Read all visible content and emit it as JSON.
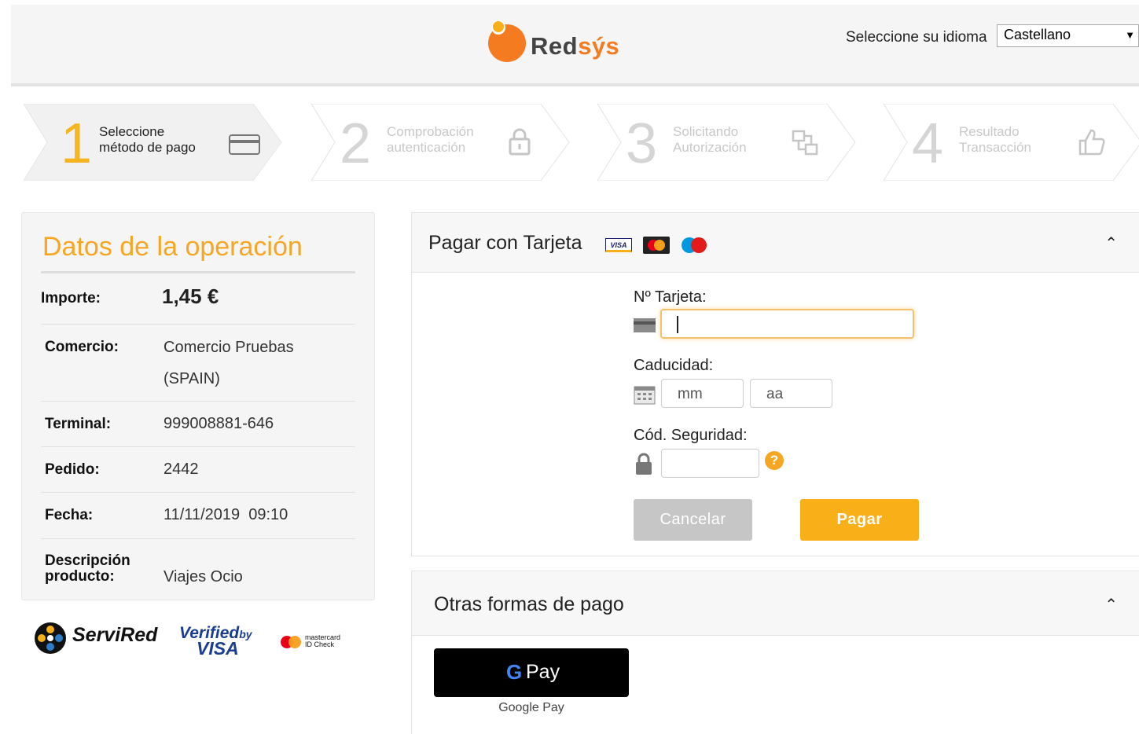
{
  "header": {
    "logo_text_a": "Red",
    "logo_text_b": "sýs",
    "language_label": "Seleccione su idioma",
    "language_selected": "Castellano"
  },
  "steps": [
    {
      "number": "1",
      "line1": "Seleccione",
      "line2": "método de pago",
      "icon": "credit-card-icon",
      "active": true
    },
    {
      "number": "2",
      "line1": "Comprobación",
      "line2": "autenticación",
      "icon": "lock-icon",
      "active": false
    },
    {
      "number": "3",
      "line1": "Solicitando",
      "line2": "Autorización",
      "icon": "transfer-icon",
      "active": false
    },
    {
      "number": "4",
      "line1": "Resultado",
      "line2": "Transacción",
      "icon": "thumbs-up-icon",
      "active": false
    }
  ],
  "operation": {
    "title": "Datos de la operación",
    "rows": [
      {
        "label": "Importe:",
        "value": "1,45 €"
      },
      {
        "label": "Comercio:",
        "value": "Comercio Pruebas",
        "value2": "(SPAIN)"
      },
      {
        "label": "Terminal:",
        "value": "999008881-646"
      },
      {
        "label": "Pedido:",
        "value": "2442"
      },
      {
        "label": "Fecha:",
        "value": "11/11/2019  09:10"
      },
      {
        "label": "Descripción",
        "label2": "producto:",
        "value": "Viajes Ocio"
      }
    ]
  },
  "brands": {
    "servired": "ServiRed",
    "verified_1": "Verified",
    "verified_by": "by",
    "verified_2": "VISA",
    "mc_line1": "mastercard",
    "mc_line2": "ID Check"
  },
  "card_panel": {
    "title": "Pagar con Tarjeta",
    "card_logos": {
      "visa": "VISA"
    },
    "card_number_label": "Nº Tarjeta:",
    "card_number_value": "",
    "expiry_label": "Caducidad:",
    "month_placeholder": "mm",
    "year_placeholder": "aa",
    "cvv_label": "Cód. Seguridad:",
    "help": "?",
    "cancel_label": "Cancelar",
    "pay_label": "Pagar"
  },
  "other_panel": {
    "title": "Otras formas de pago",
    "gpay_g": "G",
    "gpay_label": "Pay",
    "gpay_caption": "Google Pay"
  },
  "colors": {
    "accent_orange": "#f5a623",
    "pay_button": "#f9b018",
    "cancel_button": "#c6c6c6"
  }
}
